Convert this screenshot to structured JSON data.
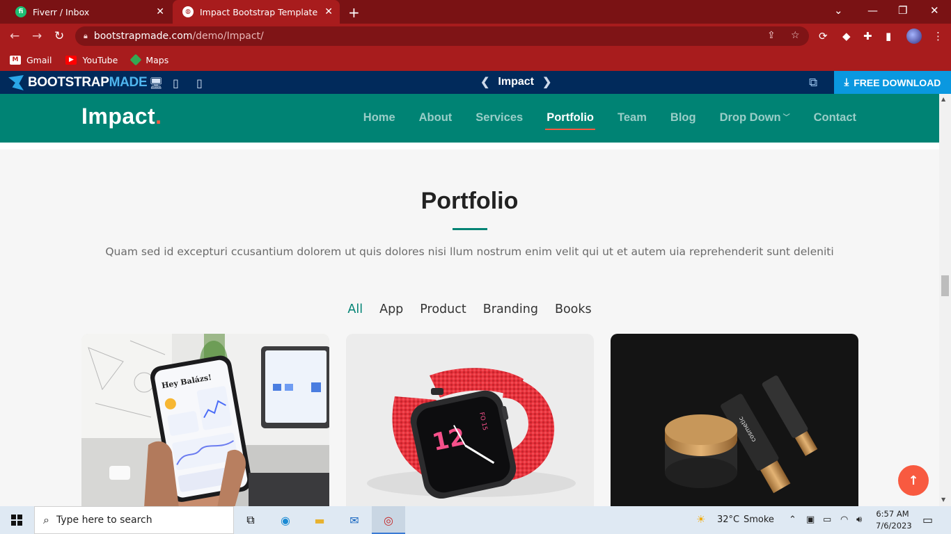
{
  "browser": {
    "tabs": [
      {
        "title": "Fiverr / Inbox",
        "active": false
      },
      {
        "title": "Impact Bootstrap Template Demo",
        "active": true
      }
    ],
    "url_host": "bootstrapmade.com",
    "url_path": "/demo/Impact/",
    "bookmarks": [
      "Gmail",
      "YouTube",
      "Maps"
    ]
  },
  "bootstrapmade_bar": {
    "logo_part1": "BOOTSTRAP",
    "logo_part2": "MADE",
    "template_name": "Impact",
    "download_label": "FREE DOWNLOAD"
  },
  "site": {
    "logo": "Impact",
    "logo_dot": ".",
    "nav": [
      "Home",
      "About",
      "Services",
      "Portfolio",
      "Team",
      "Blog",
      "Drop Down",
      "Contact"
    ],
    "active_nav": "Portfolio"
  },
  "portfolio": {
    "title": "Portfolio",
    "description": "Quam sed id excepturi ccusantium dolorem ut quis dolores nisi llum nostrum enim velit qui ut et autem uia reprehenderit sunt deleniti",
    "filters": [
      "All",
      "App",
      "Product",
      "Branding",
      "Books"
    ],
    "active_filter": "All",
    "card_texts": {
      "phone_greeting": "Hey Balázs!",
      "watch_number": "12",
      "watch_side": "FO 15",
      "tube_label": "cosmetic"
    }
  },
  "taskbar": {
    "search_placeholder": "Type here to search",
    "weather_temp": "32°C",
    "weather_desc": "Smoke",
    "time": "6:57 AM",
    "date": "7/6/2023"
  },
  "colors": {
    "accent_green": "#008374",
    "accent_orange": "#f85a40",
    "browser_red": "#a81c1d"
  }
}
